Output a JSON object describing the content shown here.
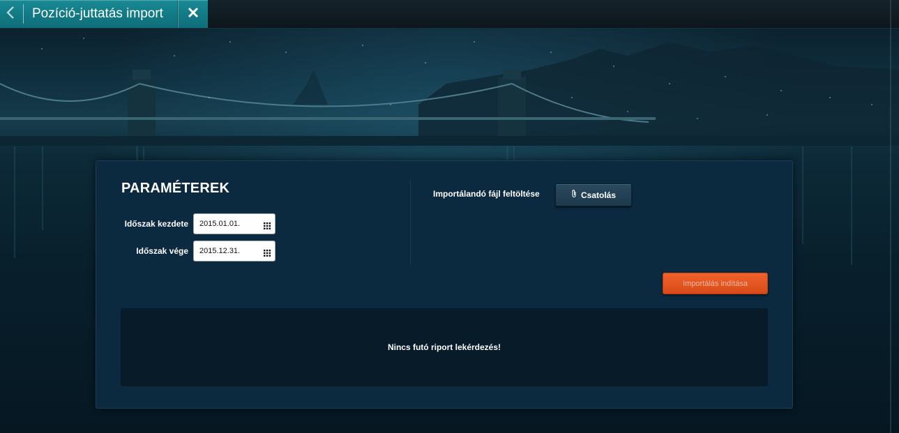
{
  "tab": {
    "title": "Pozíció-juttatás import",
    "back_icon": "chevron-left-icon",
    "close_icon": "close-icon"
  },
  "panel": {
    "title": "PARAMÉTEREK",
    "period_start": {
      "label": "Időszak kezdete",
      "value": "2015.01.01.",
      "icon": "calendar-grid-icon"
    },
    "period_end": {
      "label": "Időszak vége",
      "value": "2015.12.31.",
      "icon": "calendar-grid-icon"
    },
    "upload": {
      "label": "Importálandó fájl feltöltése",
      "button_label": "Csatolás",
      "button_icon": "paperclip-icon"
    },
    "import_button_label": "Importálás indítása",
    "report_message": "Nincs futó riport lekérdezés!"
  },
  "colors": {
    "tab_accent": "#127b86",
    "panel_bg": "#0b2a40",
    "report_bg": "#071b29",
    "import_button": "#e5541f"
  }
}
